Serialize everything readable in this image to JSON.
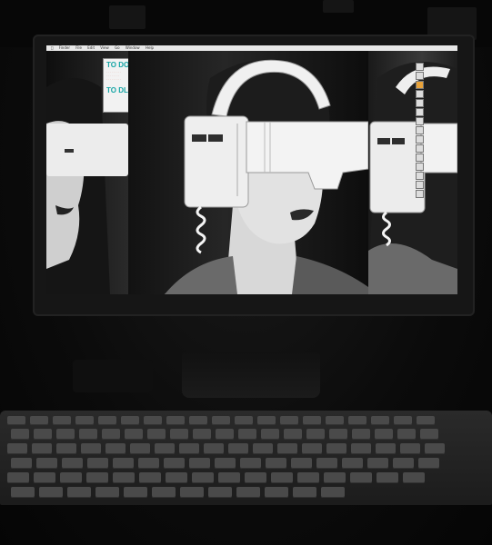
{
  "scene": {
    "description_label": "Desktop monitor displaying a triptych of a person wearing a white head-mounted display, with a keyboard in the foreground"
  },
  "menubar": {
    "items": [
      "Finder",
      "File",
      "Edit",
      "View",
      "Go",
      "Window",
      "Help"
    ],
    "status": ""
  },
  "todo_note": {
    "heading1": "TO DO:",
    "heading2": "TO DL:"
  },
  "desktop_icons": [
    {
      "label": ""
    },
    {
      "label": ""
    },
    {
      "label": ""
    },
    {
      "label": ""
    },
    {
      "label": ""
    },
    {
      "label": ""
    },
    {
      "label": ""
    },
    {
      "label": ""
    },
    {
      "label": ""
    },
    {
      "label": ""
    },
    {
      "label": ""
    },
    {
      "label": ""
    },
    {
      "label": ""
    },
    {
      "label": ""
    },
    {
      "label": ""
    }
  ],
  "colors": {
    "todo_accent": "#16a5a5",
    "screen_bg": "#bdbdbd",
    "headset": "#e9e9e9"
  }
}
